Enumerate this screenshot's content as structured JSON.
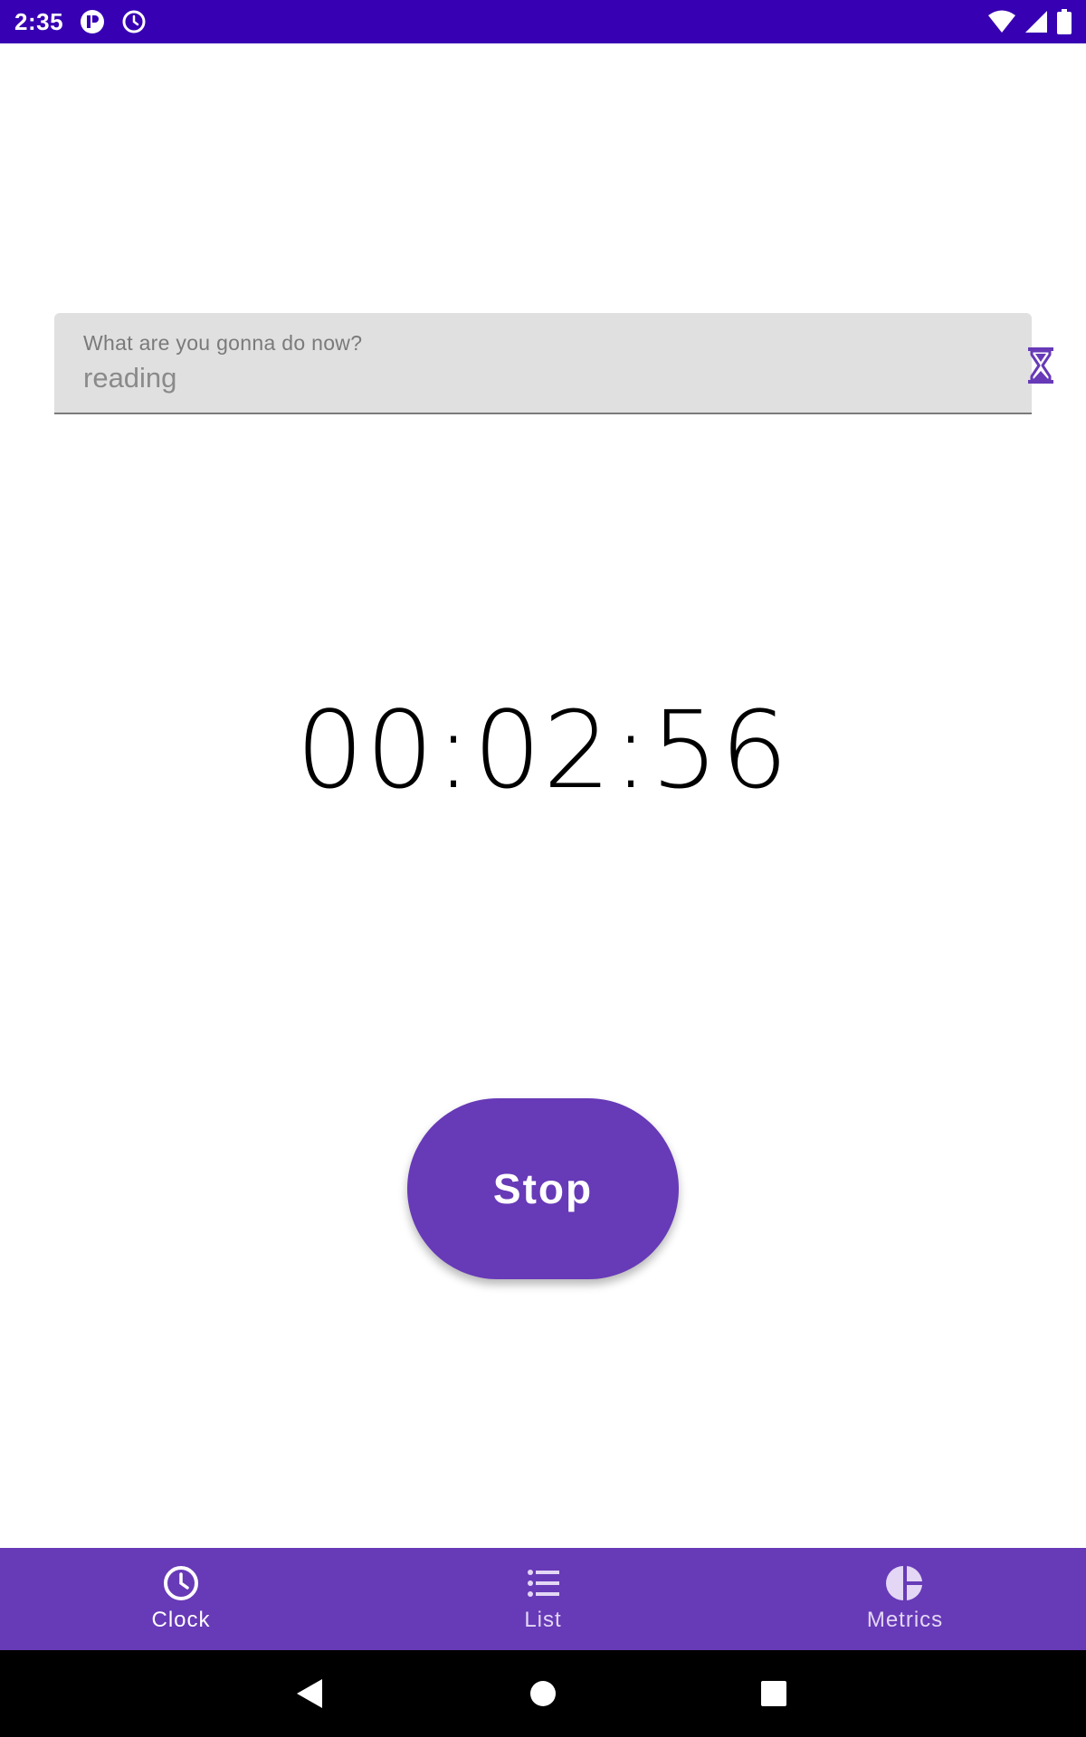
{
  "status_bar": {
    "time": "2:35",
    "icons": [
      "app-notification-icon",
      "alarm-icon",
      "wifi-icon",
      "signal-icon",
      "battery-icon"
    ]
  },
  "task": {
    "label": "What are you gonna do now?",
    "value": "reading",
    "icon": "hourglass-icon"
  },
  "timer": {
    "display": "00:02:56"
  },
  "actions": {
    "stop_label": "Stop"
  },
  "bottom_nav": {
    "items": [
      {
        "label": "Clock",
        "icon": "clock-icon",
        "active": true
      },
      {
        "label": "List",
        "icon": "list-icon",
        "active": false
      },
      {
        "label": "Metrics",
        "icon": "pie-chart-icon",
        "active": false
      }
    ]
  },
  "system_nav": {
    "icons": [
      "back-icon",
      "home-icon",
      "recents-icon"
    ]
  },
  "colors": {
    "status_bar": "#3700b3",
    "primary": "#673ab7",
    "field_background": "#e0e0e0",
    "system_nav": "#000000"
  }
}
